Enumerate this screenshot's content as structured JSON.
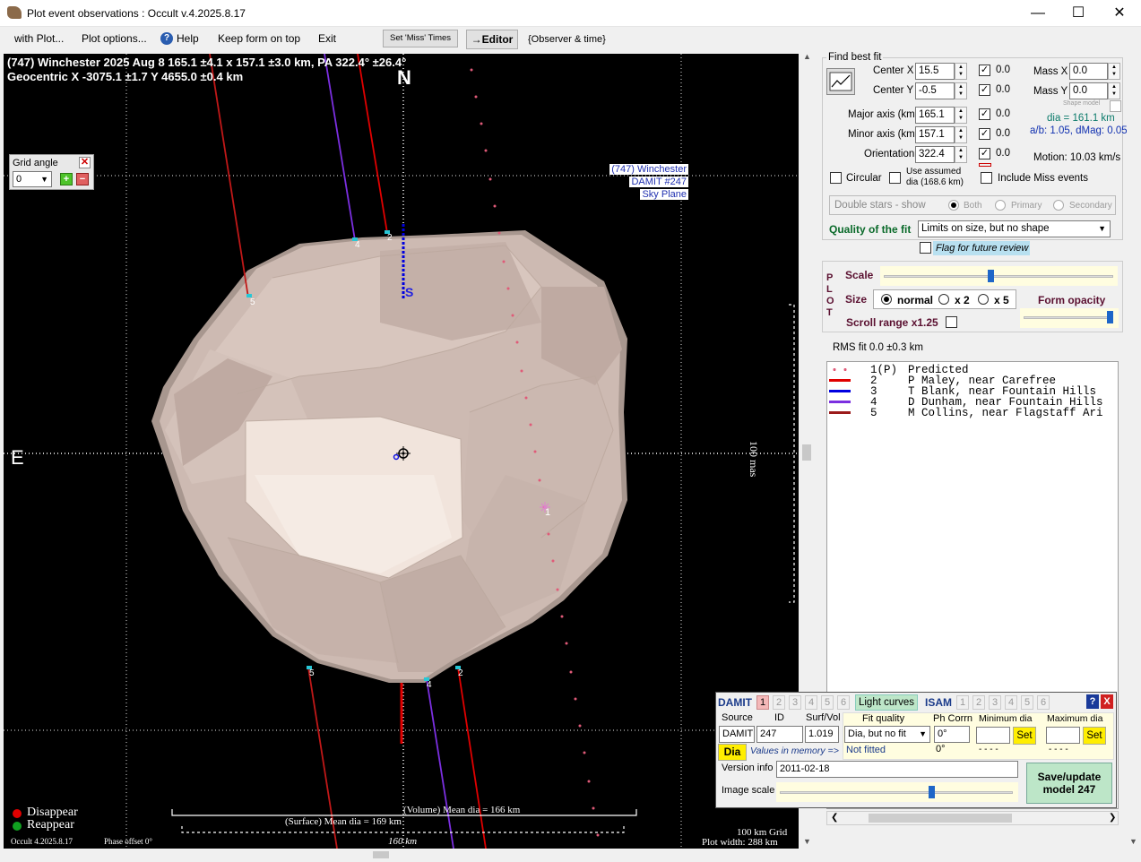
{
  "window": {
    "title": "Plot event observations : Occult v.4.2025.8.17",
    "minimize": "—",
    "maximize": "☐",
    "close": "✕"
  },
  "menu": {
    "with_plot": "with Plot...",
    "plot_options": "Plot options...",
    "help": "Help",
    "keep_on_top": "Keep form on top",
    "exit": "Exit",
    "set_miss_times": "Set 'Miss' Times",
    "editor": "→Editor",
    "observer_time": "{Observer & time}"
  },
  "plot": {
    "header_line1": "(747) Winchester  2025 Aug 8   165.1 ±4.1 x 157.1 ±3.0 km,  PA 322.4° ±26.4°",
    "header_line2": "Geocentric  X  -3075.1 ±1.7  Y 4655.0 ±0.4 km",
    "north": "N",
    "east": "E",
    "south_marker": "S",
    "grid_angle_label": "Grid angle",
    "grid_angle_value": "0",
    "model_label": [
      "(747) Winchester",
      "DAMIT #247",
      "Sky Plane"
    ],
    "scale_mas": "100 mas",
    "legend_disappear": "Disappear",
    "legend_reappear": "Reappear",
    "volume_dia": "(Volume) Mean dia = 166 km",
    "surface_dia": "(Surface) Mean dia = 169 km",
    "span_km": "160 km",
    "version": "Occult 4.2025.8.17",
    "phase_offset": "Phase offset 0°",
    "grid_km": "100 km Grid",
    "plot_width": "Plot width: 288 km",
    "chord_labels": {
      "c1": "1",
      "c2": "2",
      "c4": "4",
      "c5": "5"
    }
  },
  "fit": {
    "find_best_fit": "Find best fit",
    "center_x_label": "Center X",
    "center_x": "15.5",
    "center_x_chk": "0.0",
    "center_y_label": "Center Y",
    "center_y": "-0.5",
    "center_y_chk": "0.0",
    "major_label": "Major axis (km)",
    "major": "165.1",
    "major_chk": "0.0",
    "minor_label": "Minor axis (km)",
    "minor": "157.1",
    "minor_chk": "0.0",
    "orient_label": "Orientation",
    "orient": "322.4",
    "orient_chk": "0.0",
    "mass_x_label": "Mass X",
    "mass_x": "0.0",
    "mass_y_label": "Mass Y",
    "mass_y": "0.0",
    "shape_model": "Shape model",
    "dia": "dia = 161.1 km",
    "ab": "a/b: 1.05, dMag: 0.05",
    "motion": "Motion: 10.03 km/s",
    "circular": "Circular",
    "use_assumed": "Use assumed",
    "assumed_dia": "dia (168.6 km)",
    "include_miss": "Include Miss events",
    "double_stars": "Double stars - show",
    "both": "Both",
    "primary": "Primary",
    "secondary": "Secondary",
    "quality_label": "Quality of the fit",
    "quality_value": "Limits on size, but no shape",
    "flag_review": "Flag for future review"
  },
  "plotbox": {
    "plot_letters": [
      "P",
      "L",
      "O",
      "T"
    ],
    "scale": "Scale",
    "size": "Size",
    "normal": "normal",
    "x2": "x 2",
    "x5": "x 5",
    "form_opacity": "Form opacity",
    "scroll_range": "Scroll range x1.25",
    "rms": "RMS fit 0.0 ±0.3 km",
    "scale_level": 0.46,
    "opacity_level": 0.97
  },
  "observers": [
    {
      "num": "1(P)",
      "name": "Predicted",
      "color": "#e05a78",
      "style": "dots"
    },
    {
      "num": "2",
      "name": "P Maley, near Carefree",
      "color": "#e00000",
      "style": "line"
    },
    {
      "num": "3",
      "name": "T Blank, near Fountain Hills",
      "color": "#0000e0",
      "style": "line"
    },
    {
      "num": "4",
      "name": "D Dunham, near Fountain Hills",
      "color": "#7b2fe0",
      "style": "line"
    },
    {
      "num": "5",
      "name": "M Collins, near Flagstaff Ari",
      "color": "#9b1b1b",
      "style": "line"
    }
  ],
  "damit": {
    "damit_label": "DAMIT",
    "damit_nums": [
      "1",
      "2",
      "3",
      "4",
      "5",
      "6"
    ],
    "light_curves": "Light curves",
    "isam_label": "ISAM",
    "isam_nums": [
      "1",
      "2",
      "3",
      "4",
      "5",
      "6"
    ],
    "help": "?",
    "close": "X",
    "source_h": "Source",
    "id_h": "ID",
    "surf_h": "Surf/Vol",
    "source": "DAMIT",
    "id": "247",
    "surf": "1.019",
    "fit_quality_h": "Fit quality",
    "fit_quality": "Dia, but no fit",
    "not_fitted": "Not fitted",
    "ph_corr_h": "Ph Corrn",
    "ph_corr": "0°",
    "ph_corr2": "0°",
    "min_dia_h": "Minimum dia",
    "max_dia_h": "Maximum dia",
    "set": "Set",
    "dashes": "- - - -",
    "dia_btn": "Dia",
    "values_in_memory": "Values in memory =>",
    "version_info_label": "Version info",
    "version_info": "2011-02-18",
    "image_scale_label": "Image scale",
    "save_update": "Save/update model 247",
    "image_scale_level": 0.65
  }
}
